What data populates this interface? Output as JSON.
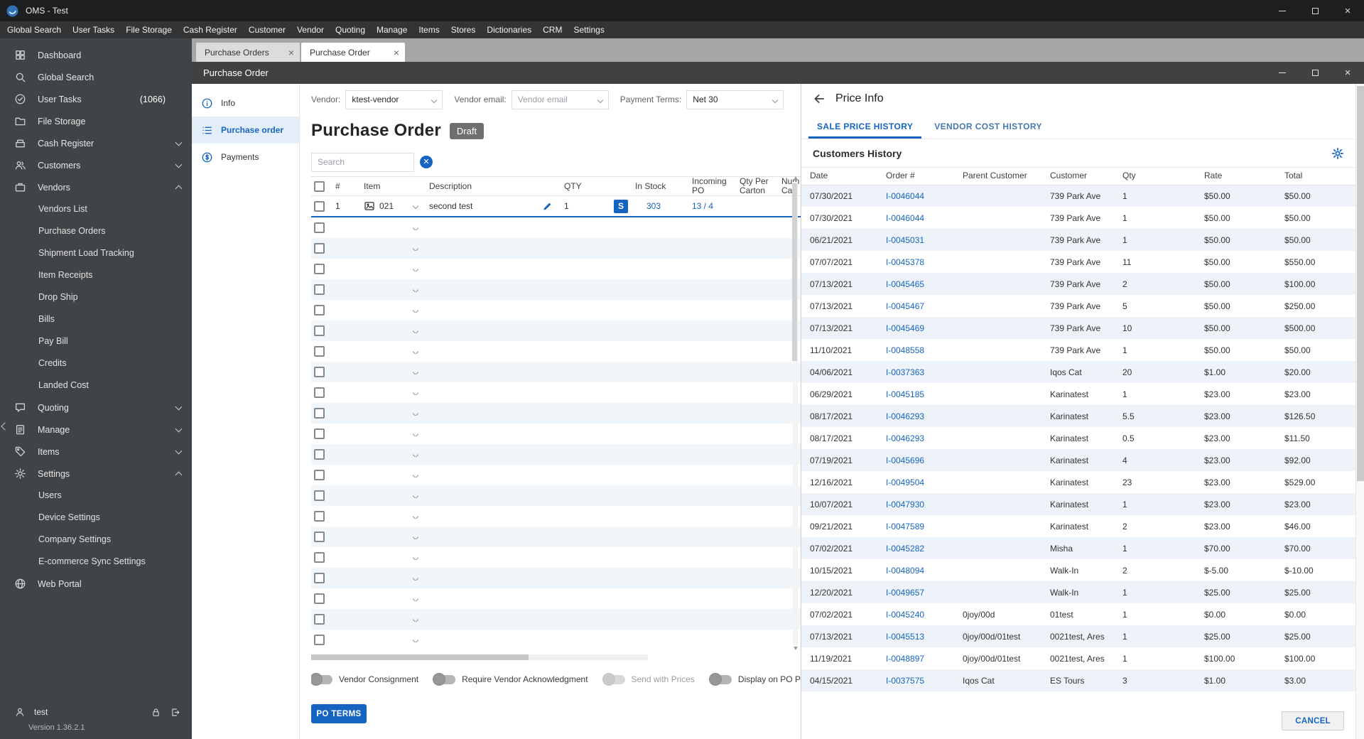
{
  "colors": {
    "accent": "#1565c0",
    "dark_header": "#3f4143",
    "stripe": "#edf3f8"
  },
  "titlebar": {
    "title": "OMS - Test"
  },
  "menubar": {
    "items": [
      "Global Search",
      "User Tasks",
      "File Storage",
      "Cash Register",
      "Customer",
      "Vendor",
      "Quoting",
      "Manage",
      "Items",
      "Stores",
      "Dictionaries",
      "CRM",
      "Settings"
    ]
  },
  "sidebar": {
    "items": [
      {
        "id": "dashboard",
        "label": "Dashboard",
        "icon": "grid"
      },
      {
        "id": "global-search",
        "label": "Global Search",
        "icon": "search"
      },
      {
        "id": "user-tasks",
        "label": "User Tasks",
        "icon": "check-circle",
        "badge": "(1066)"
      },
      {
        "id": "file-storage",
        "label": "File Storage",
        "icon": "folder"
      },
      {
        "id": "cash-register",
        "label": "Cash Register",
        "icon": "cash",
        "chevron": "down"
      },
      {
        "id": "customers",
        "label": "Customers",
        "icon": "people",
        "chevron": "down"
      },
      {
        "id": "vendors",
        "label": "Vendors",
        "icon": "briefcase",
        "chevron": "up",
        "children": [
          "Vendors List",
          "Purchase Orders",
          "Shipment Load Tracking",
          "Item Receipts",
          "Drop Ship",
          "Bills",
          "Pay Bill",
          "Credits",
          "Landed Cost"
        ]
      },
      {
        "id": "quoting",
        "label": "Quoting",
        "icon": "quote",
        "chevron": "down"
      },
      {
        "id": "manage",
        "label": "Manage",
        "icon": "clipboard",
        "chevron": "down"
      },
      {
        "id": "items",
        "label": "Items",
        "icon": "tag",
        "chevron": "down"
      },
      {
        "id": "settings",
        "label": "Settings",
        "icon": "gear",
        "chevron": "up",
        "children": [
          "Users",
          "Device Settings",
          "Company Settings",
          "E-commerce Sync Settings"
        ]
      },
      {
        "id": "web-portal",
        "label": "Web Portal",
        "icon": "globe"
      }
    ],
    "footer": {
      "user": "test",
      "version": "Version 1.36.2.1"
    }
  },
  "tabs": [
    {
      "label": "Purchase Orders",
      "active": false
    },
    {
      "label": "Purchase Order",
      "active": true
    }
  ],
  "po_window": {
    "title": "Purchase Order",
    "nav": [
      {
        "label": "Info",
        "active": false
      },
      {
        "label": "Purchase order",
        "active": true
      },
      {
        "label": "Payments",
        "active": false
      }
    ],
    "form": {
      "vendor_label": "Vendor:",
      "vendor_value": "ktest-vendor",
      "email_label": "Vendor email:",
      "email_placeholder": "Vendor email",
      "terms_label": "Payment Terms:",
      "terms_value": "Net 30"
    },
    "heading": "Purchase Order",
    "status_badge": "Draft",
    "search_placeholder": "Search",
    "table": {
      "columns": [
        "#",
        "Item",
        "Description",
        "QTY",
        "In Stock",
        "Incoming PO",
        "Qty Per Carton",
        "Num Cart"
      ],
      "first_row": {
        "num": "1",
        "item": "021",
        "description": "second test",
        "qty": "1",
        "stock_badge": "S",
        "in_stock": "303",
        "incoming_po": "13 / 4"
      },
      "empty_row_count": 21
    },
    "toggles": [
      {
        "label": "Vendor Consignment",
        "on": false,
        "disabled": false
      },
      {
        "label": "Require Vendor Acknowledgment",
        "on": false,
        "disabled": false
      },
      {
        "label": "Send with Prices",
        "on": false,
        "disabled": true
      },
      {
        "label": "Display on PO Pdf Custom",
        "on": false,
        "disabled": false
      }
    ],
    "po_terms_button": "PO TERMS"
  },
  "price_info": {
    "title": "Price Info",
    "tabs": [
      {
        "label": "SALE PRICE HISTORY",
        "active": true
      },
      {
        "label": "VENDOR COST HISTORY",
        "active": false
      }
    ],
    "section_title": "Customers History",
    "table": {
      "columns": [
        "Date",
        "Order #",
        "Parent Customer",
        "Customer",
        "Qty",
        "Rate",
        "Total"
      ],
      "rows": [
        [
          "07/30/2021",
          "I-0046044",
          "",
          "739 Park Ave",
          "1",
          "$50.00",
          "$50.00"
        ],
        [
          "07/30/2021",
          "I-0046044",
          "",
          "739 Park Ave",
          "1",
          "$50.00",
          "$50.00"
        ],
        [
          "06/21/2021",
          "I-0045031",
          "",
          "739 Park Ave",
          "1",
          "$50.00",
          "$50.00"
        ],
        [
          "07/07/2021",
          "I-0045378",
          "",
          "739 Park Ave",
          "11",
          "$50.00",
          "$550.00"
        ],
        [
          "07/13/2021",
          "I-0045465",
          "",
          "739 Park Ave",
          "2",
          "$50.00",
          "$100.00"
        ],
        [
          "07/13/2021",
          "I-0045467",
          "",
          "739 Park Ave",
          "5",
          "$50.00",
          "$250.00"
        ],
        [
          "07/13/2021",
          "I-0045469",
          "",
          "739 Park Ave",
          "10",
          "$50.00",
          "$500.00"
        ],
        [
          "11/10/2021",
          "I-0048558",
          "",
          "739 Park Ave",
          "1",
          "$50.00",
          "$50.00"
        ],
        [
          "04/06/2021",
          "I-0037363",
          "",
          "Iqos Cat",
          "20",
          "$1.00",
          "$20.00"
        ],
        [
          "06/29/2021",
          "I-0045185",
          "",
          "Karinatest",
          "1",
          "$23.00",
          "$23.00"
        ],
        [
          "08/17/2021",
          "I-0046293",
          "",
          "Karinatest",
          "5.5",
          "$23.00",
          "$126.50"
        ],
        [
          "08/17/2021",
          "I-0046293",
          "",
          "Karinatest",
          "0.5",
          "$23.00",
          "$11.50"
        ],
        [
          "07/19/2021",
          "I-0045696",
          "",
          "Karinatest",
          "4",
          "$23.00",
          "$92.00"
        ],
        [
          "12/16/2021",
          "I-0049504",
          "",
          "Karinatest",
          "23",
          "$23.00",
          "$529.00"
        ],
        [
          "10/07/2021",
          "I-0047930",
          "",
          "Karinatest",
          "1",
          "$23.00",
          "$23.00"
        ],
        [
          "09/21/2021",
          "I-0047589",
          "",
          "Karinatest",
          "2",
          "$23.00",
          "$46.00"
        ],
        [
          "07/02/2021",
          "I-0045282",
          "",
          "Misha",
          "1",
          "$70.00",
          "$70.00"
        ],
        [
          "10/15/2021",
          "I-0048094",
          "",
          "Walk-In",
          "2",
          "$-5.00",
          "$-10.00"
        ],
        [
          "12/20/2021",
          "I-0049657",
          "",
          "Walk-In",
          "1",
          "$25.00",
          "$25.00"
        ],
        [
          "07/02/2021",
          "I-0045240",
          "0joy/00d",
          "01test",
          "1",
          "$0.00",
          "$0.00"
        ],
        [
          "07/13/2021",
          "I-0045513",
          "0joy/00d/01test",
          "0021test, Ares",
          "1",
          "$25.00",
          "$25.00"
        ],
        [
          "11/19/2021",
          "I-0048897",
          "0joy/00d/01test",
          "0021test, Ares",
          "1",
          "$100.00",
          "$100.00"
        ],
        [
          "04/15/2021",
          "I-0037575",
          "Iqos Cat",
          "ES Tours",
          "3",
          "$1.00",
          "$3.00"
        ]
      ]
    },
    "cancel_button": "CANCEL"
  }
}
